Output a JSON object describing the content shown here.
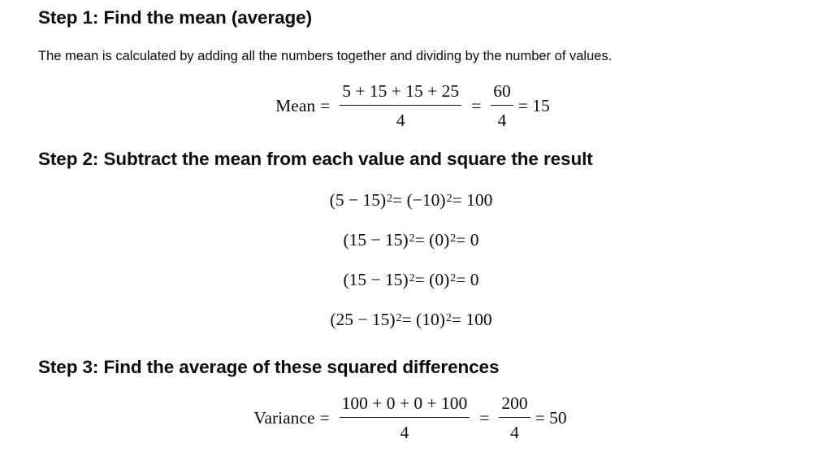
{
  "step1": {
    "heading": "Step 1: Find the mean (average)",
    "paragraph": "The mean is calculated by adding all the numbers together and dividing by the number of values.",
    "formula": {
      "label": "Mean",
      "eq": "=",
      "frac1_num": "5 + 15 + 15 + 25",
      "frac1_den": "4",
      "frac2_num": "60",
      "frac2_den": "4",
      "result": "= 15"
    }
  },
  "step2": {
    "heading": "Step 2: Subtract the mean from each value and square the result",
    "equations": [
      {
        "lhs": "(5 − 15)",
        "mid": " = (−10)",
        "rhs": " = 100",
        "exp": "2"
      },
      {
        "lhs": "(15 − 15)",
        "mid": " = (0)",
        "rhs": " = 0",
        "exp": "2"
      },
      {
        "lhs": "(15 − 15)",
        "mid": " = (0)",
        "rhs": " = 0",
        "exp": "2"
      },
      {
        "lhs": "(25 − 15)",
        "mid": " = (10)",
        "rhs": " = 100",
        "exp": "2"
      }
    ]
  },
  "step3": {
    "heading": "Step 3: Find the average of these squared differences",
    "formula": {
      "label": "Variance",
      "eq": "=",
      "frac1_num": "100 + 0 + 0 + 100",
      "frac1_den": "4",
      "frac2_num": "200",
      "frac2_den": "4",
      "result": "= 50"
    }
  }
}
